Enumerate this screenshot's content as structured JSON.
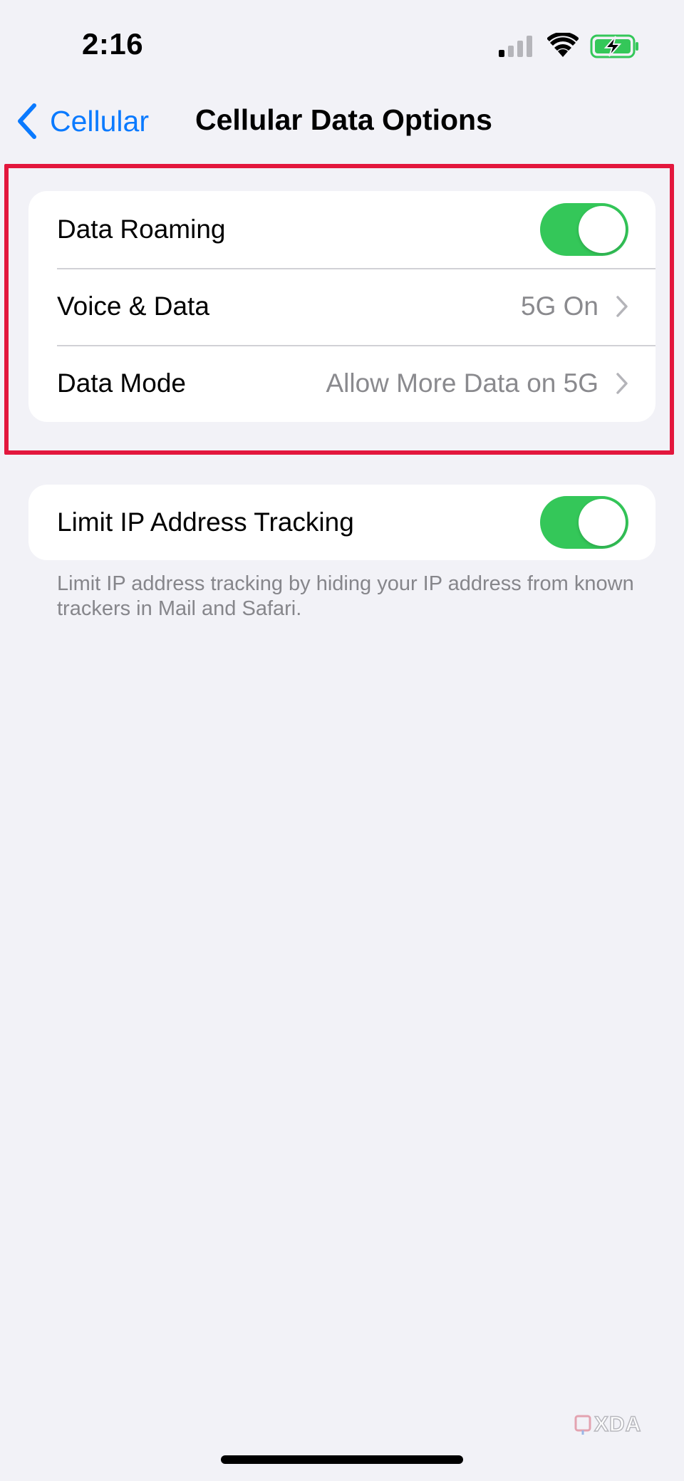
{
  "status_bar": {
    "time": "2:16",
    "icons": [
      "cellular-signal-icon",
      "wifi-icon",
      "battery-charging-icon"
    ],
    "battery_color": "#34c759"
  },
  "nav": {
    "back_label": "Cellular",
    "title": "Cellular Data Options"
  },
  "group1": {
    "data_roaming": {
      "label": "Data Roaming",
      "on": true
    },
    "voice_data": {
      "label": "Voice & Data",
      "value": "5G On"
    },
    "data_mode": {
      "label": "Data Mode",
      "value": "Allow More Data on 5G"
    }
  },
  "group2": {
    "limit_ip": {
      "label": "Limit IP Address Tracking",
      "on": true
    },
    "footnote": "Limit IP address tracking by hiding your IP address from known trackers in Mail and Safari."
  },
  "watermark": "XDA",
  "colors": {
    "accent": "#0a7aff",
    "toggle_on": "#34c759",
    "highlight": "#e3173d",
    "background": "#f2f2f7"
  }
}
